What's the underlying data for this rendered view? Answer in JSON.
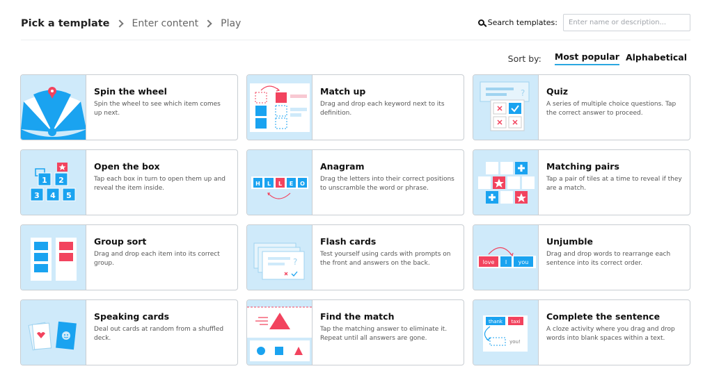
{
  "breadcrumb": {
    "step1": "Pick a template",
    "step2": "Enter content",
    "step3": "Play"
  },
  "search": {
    "label": "Search templates:",
    "placeholder": "Enter name or description...",
    "icon": "search-icon"
  },
  "sort": {
    "label": "Sort by:",
    "options": [
      "Most popular",
      "Alphabetical"
    ],
    "selected": "Most popular"
  },
  "colors": {
    "accent": "#2aa7e0",
    "thumb_bg": "#cfeafa",
    "blue": "#1aa3f0",
    "red": "#f2435e"
  },
  "templates": [
    {
      "title": "Spin the wheel",
      "desc": "Spin the wheel to see which item comes up next.",
      "icon": "wheel-icon"
    },
    {
      "title": "Match up",
      "desc": "Drag and drop each keyword next to its definition.",
      "icon": "match-up-icon"
    },
    {
      "title": "Quiz",
      "desc": "A series of multiple choice questions. Tap the correct answer to proceed.",
      "icon": "quiz-icon"
    },
    {
      "title": "Open the box",
      "desc": "Tap each box in turn to open them up and reveal the item inside.",
      "icon": "boxes-icon"
    },
    {
      "title": "Anagram",
      "desc": "Drag the letters into their correct positions to unscramble the word or phrase.",
      "icon": "anagram-icon"
    },
    {
      "title": "Matching pairs",
      "desc": "Tap a pair of tiles at a time to reveal if they are a match.",
      "icon": "tiles-icon"
    },
    {
      "title": "Group sort",
      "desc": "Drag and drop each item into its correct group.",
      "icon": "group-sort-icon"
    },
    {
      "title": "Flash cards",
      "desc": "Test yourself using cards with prompts on the front and answers on the back.",
      "icon": "flash-cards-icon"
    },
    {
      "title": "Unjumble",
      "desc": "Drag and drop words to rearrange each sentence into its correct order.",
      "icon": "unjumble-icon"
    },
    {
      "title": "Speaking cards",
      "desc": "Deal out cards at random from a shuffled deck.",
      "icon": "speaking-cards-icon"
    },
    {
      "title": "Find the match",
      "desc": "Tap the matching answer to eliminate it. Repeat until all answers are gone.",
      "icon": "find-match-icon"
    },
    {
      "title": "Complete the sentence",
      "desc": "A cloze activity where you drag and drop words into blank spaces within a text.",
      "icon": "cloze-icon"
    }
  ],
  "thumb_text": {
    "box_numbers": [
      "1",
      "2",
      "3",
      "4",
      "5"
    ],
    "anagram_letters": [
      "H",
      "L",
      "L",
      "E",
      "O"
    ],
    "unjumble_words": [
      "love",
      "I",
      "you"
    ],
    "cloze_words": [
      "thank",
      "taxi",
      "you!"
    ]
  }
}
